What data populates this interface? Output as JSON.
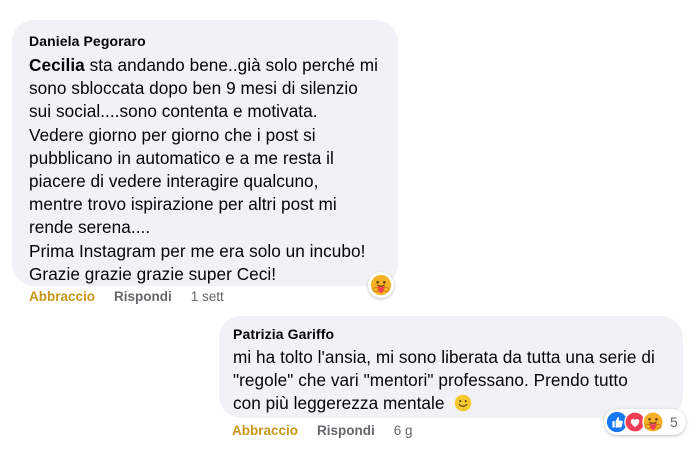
{
  "comments": [
    {
      "author": "Daniela Pegoraro",
      "mention": "Cecilia",
      "lines": [
        " sta andando bene..già solo perché mi",
        "sono sbloccata dopo ben 9 mesi di silenzio",
        "sui social....sono contenta e motivata.",
        "Vedere giorno per giorno che i post si",
        "pubblicano in automatico e a me resta il",
        "piacere di vedere interagire qualcuno,",
        "mentre trovo ispirazione per altri post mi",
        "rende serena....",
        "Prima Instagram per me era solo un incubo!",
        "Grazie grazie grazie super Ceci!"
      ],
      "reaction_label": "Abbraccio",
      "reply_label": "Rispondi",
      "time": "1 sett",
      "reactions": [
        "care-icon"
      ]
    },
    {
      "author": "Patrizia Gariffo",
      "lines": [
        "mi ha tolto l'ansia, mi sono liberata da tutta una serie di",
        "\"regole\" che vari \"mentori\" professano. Prendo tutto",
        "con più leggerezza mentale"
      ],
      "emoji": "smile-emoji",
      "reaction_label": "Abbraccio",
      "reply_label": "Rispondi",
      "time": "6 g",
      "reactions": [
        "like-icon",
        "love-icon",
        "care-icon"
      ],
      "reaction_count": "5"
    }
  ],
  "colors": {
    "bubble": "#f0f2f5",
    "reaction_active": "#c8951a",
    "meta": "#65676b",
    "like": "#1877f2",
    "love": "#f33e58",
    "care": "#f7b125"
  }
}
